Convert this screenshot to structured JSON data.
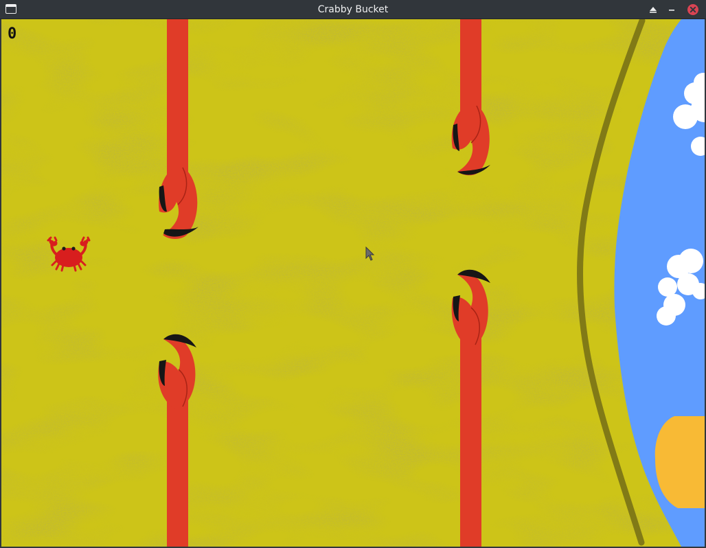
{
  "window": {
    "title": "Crabby Bucket",
    "icons": [
      "window-icon",
      "keep-above-icon",
      "minimize-icon",
      "close-icon"
    ]
  },
  "game": {
    "score": "0",
    "colors": {
      "sand": "#cdc418",
      "sand_speckle": "#8f8410",
      "claw": "#e03c28",
      "claw_tip": "#161616",
      "crab": "#d81e1e",
      "shoreline": "#817a16",
      "sea": "#5f9cff",
      "cloud": "#ffffff",
      "sun": "#f8ba35"
    },
    "sprites": [
      "player-crab",
      "claw-pipe-top-1",
      "claw-pipe-bottom-1",
      "claw-pipe-top-2",
      "claw-pipe-bottom-2",
      "sea",
      "clouds",
      "sun",
      "shoreline",
      "mouse-cursor"
    ]
  }
}
